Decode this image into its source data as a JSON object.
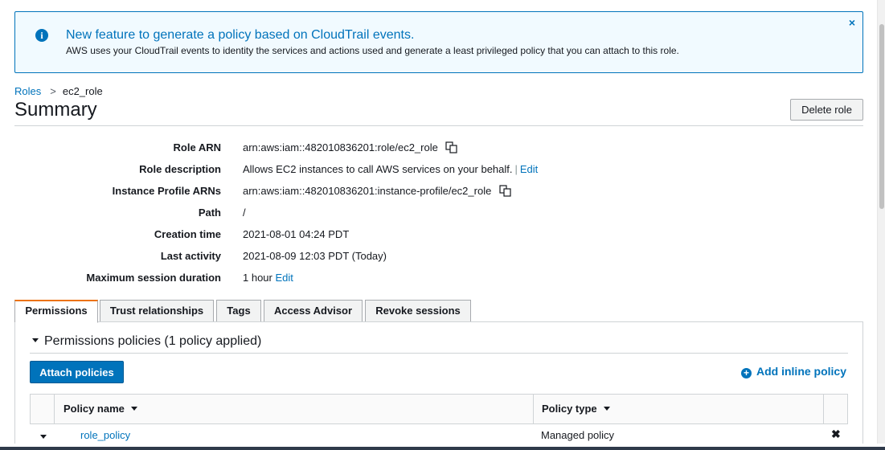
{
  "banner": {
    "title": "New feature to generate a policy based on CloudTrail events.",
    "text": "AWS uses your CloudTrail events to identity the services and actions used and generate a least privileged policy that you can attach to this role.",
    "info_icon": "i",
    "close_icon": "×"
  },
  "breadcrumb": {
    "root": "Roles",
    "separator": ">",
    "current": "ec2_role"
  },
  "page": {
    "title": "Summary",
    "delete_label": "Delete role"
  },
  "summary": {
    "role_arn": {
      "label": "Role ARN",
      "value": "arn:aws:iam::482010836201:role/ec2_role"
    },
    "role_description": {
      "label": "Role description",
      "value": "Allows EC2 instances to call AWS services on your behalf.",
      "pipe": "|",
      "edit": "Edit"
    },
    "instance_profile": {
      "label": "Instance Profile ARNs",
      "value": "arn:aws:iam::482010836201:instance-profile/ec2_role"
    },
    "path": {
      "label": "Path",
      "value": "/"
    },
    "creation_time": {
      "label": "Creation time",
      "value": "2021-08-01 04:24 PDT"
    },
    "last_activity": {
      "label": "Last activity",
      "value": "2021-08-09 12:03 PDT (Today)"
    },
    "max_session": {
      "label": "Maximum session duration",
      "value": "1 hour",
      "edit": "Edit"
    }
  },
  "tabs": {
    "permissions": "Permissions",
    "trust": "Trust relationships",
    "tags": "Tags",
    "access_advisor": "Access Advisor",
    "revoke": "Revoke sessions"
  },
  "permissions": {
    "section_title": "Permissions policies (1 policy applied)",
    "attach_label": "Attach policies",
    "add_inline_label": "Add inline policy",
    "plus_icon": "+",
    "columns": {
      "name": "Policy name",
      "type": "Policy type"
    },
    "rows": [
      {
        "name": "role_policy",
        "type": "Managed policy",
        "remove_icon": "✖"
      }
    ]
  },
  "colors": {
    "accent": "#0073bb",
    "active_tab": "#ec7211",
    "banner_bg": "#f1faff"
  }
}
